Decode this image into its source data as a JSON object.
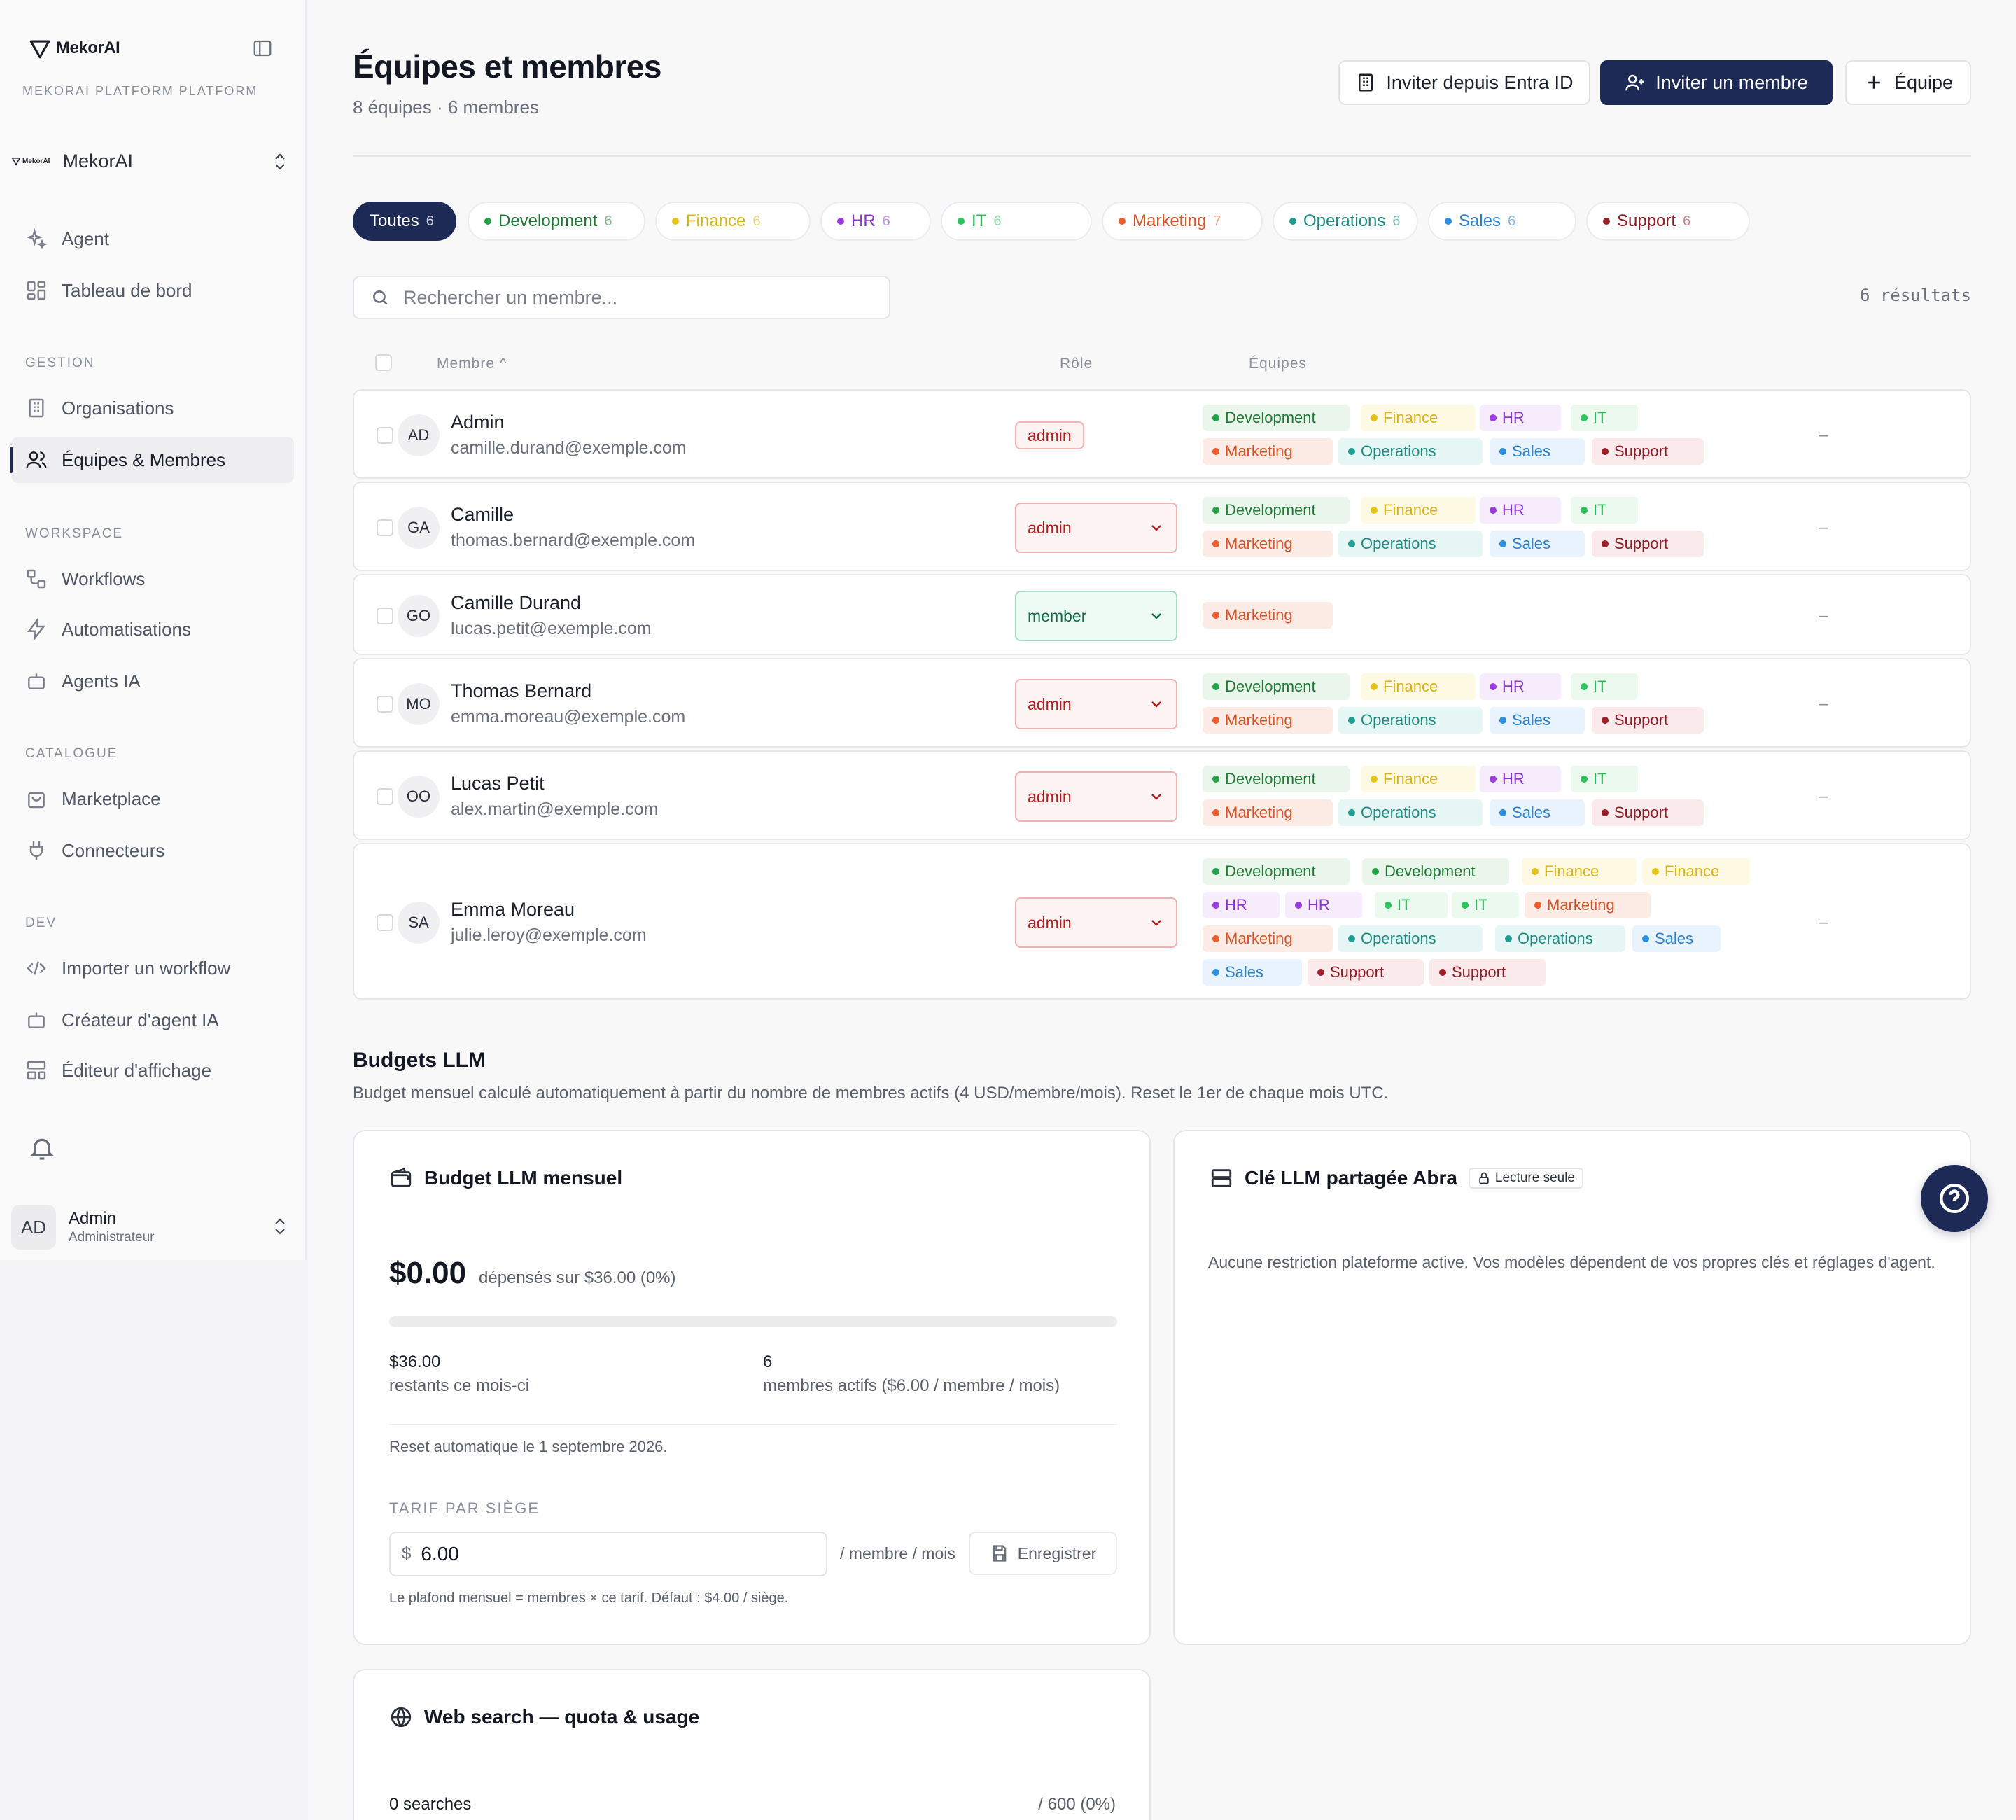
{
  "sidebar": {
    "brand": "MekorAI",
    "platform": "MEKORAI PLATFORM PLATFORM",
    "org": {
      "mini": "MekorAI",
      "name": "MekorAI"
    },
    "items": [
      {
        "label": "Agent",
        "icon": "sparkles-icon"
      },
      {
        "label": "Tableau de bord",
        "icon": "dashboard-icon"
      },
      {
        "label": "Organisations",
        "icon": "building-icon"
      },
      {
        "label": "Équipes & Membres",
        "icon": "users-icon"
      },
      {
        "label": "Workflows",
        "icon": "workflow-icon"
      },
      {
        "label": "Automatisations",
        "icon": "bolt-icon"
      },
      {
        "label": "Agents IA",
        "icon": "bot-icon"
      },
      {
        "label": "Marketplace",
        "icon": "bag-icon"
      },
      {
        "label": "Connecteurs",
        "icon": "plug-icon"
      },
      {
        "label": "Importer un workflow",
        "icon": "code-icon"
      },
      {
        "label": "Créateur d'agent IA",
        "icon": "bot-icon"
      },
      {
        "label": "Éditeur d'affichage",
        "icon": "layout-icon"
      }
    ],
    "sections": {
      "gestion": "GESTION",
      "workspace": "WORKSPACE",
      "catalogue": "CATALOGUE",
      "dev": "DEV"
    },
    "user": {
      "initials": "AD",
      "name": "Admin",
      "role": "Administrateur"
    }
  },
  "header": {
    "title": "Équipes et membres",
    "subtitle": "8 équipes · 6 membres",
    "btn_entra": "Inviter depuis Entra ID",
    "btn_invite": "Inviter un membre",
    "btn_team": "Équipe"
  },
  "filters": [
    {
      "label": "Toutes",
      "count": "6"
    },
    {
      "label": "Development",
      "count": "6",
      "color": "#22a046"
    },
    {
      "label": "Finance",
      "count": "6",
      "color": "#e3c21b"
    },
    {
      "label": "HR",
      "count": "6",
      "color": "#9b3de0"
    },
    {
      "label": "IT",
      "count": "6",
      "color": "#2bc25c"
    },
    {
      "label": "Marketing",
      "count": "7",
      "color": "#ee5a2b"
    },
    {
      "label": "Operations",
      "count": "6",
      "color": "#1e9d93"
    },
    {
      "label": "Sales",
      "count": "6",
      "color": "#2b8fe0"
    },
    {
      "label": "Support",
      "count": "6",
      "color": "#9c1f2a"
    }
  ],
  "search": {
    "placeholder": "Rechercher un membre...",
    "results": "6 résultats"
  },
  "table": {
    "headers": {
      "member": "Membre ^",
      "role": "Rôle",
      "teams": "Équipes"
    },
    "rows": [
      {
        "initials": "AD",
        "name": "Admin",
        "email": "camille.durand@exemple.com",
        "role": "admin",
        "teams": [
          "Development",
          "Finance",
          "HR",
          "IT",
          "Marketing",
          "Operations",
          "Sales",
          "Support"
        ],
        "dash": "–"
      },
      {
        "initials": "GA",
        "name": "Camille",
        "email": "thomas.bernard@exemple.com",
        "role": "admin",
        "teams": [
          "Development",
          "Finance",
          "HR",
          "IT",
          "Marketing",
          "Operations",
          "Sales",
          "Support"
        ],
        "dash": "–"
      },
      {
        "initials": "GO",
        "name": "Camille Durand",
        "email": "lucas.petit@exemple.com",
        "role": "member",
        "teams": [
          "Marketing"
        ],
        "dash": "–"
      },
      {
        "initials": "MO",
        "name": "Thomas Bernard",
        "email": "emma.moreau@exemple.com",
        "role": "admin",
        "teams": [
          "Development",
          "Finance",
          "HR",
          "IT",
          "Marketing",
          "Operations",
          "Sales",
          "Support"
        ],
        "dash": "–"
      },
      {
        "initials": "OO",
        "name": "Lucas Petit",
        "email": "alex.martin@exemple.com",
        "role": "admin",
        "teams": [
          "Development",
          "Finance",
          "HR",
          "IT",
          "Marketing",
          "Operations",
          "Sales",
          "Support"
        ],
        "dash": "–"
      },
      {
        "initials": "SA",
        "name": "Emma Moreau",
        "email": "julie.leroy@exemple.com",
        "role": "admin",
        "teams": [
          "Development",
          "Development",
          "Finance",
          "Finance",
          "HR",
          "HR",
          "IT",
          "IT",
          "Marketing",
          "Marketing",
          "Operations",
          "Operations",
          "Sales",
          "Sales",
          "Support",
          "Support"
        ],
        "dash": "–"
      }
    ]
  },
  "budgets": {
    "title": "Budgets LLM",
    "subtitle": "Budget mensuel calculé automatiquement à partir du nombre de membres actifs (4 USD/membre/mois). Reset le 1er de chaque mois UTC.",
    "monthly": {
      "title": "Budget LLM mensuel",
      "spent": "$0.00",
      "spent_label": "dépensés sur $36.00 (0%)",
      "progress": 0,
      "remaining": "$36.00",
      "remaining_label": "restants ce mois-ci",
      "members": "6",
      "members_label": "membres actifs ($6.00 / membre / mois)",
      "reset": "Reset automatique le 1 septembre 2026.",
      "tarif_label": "TARIF PAR SIÈGE",
      "currency": "$",
      "price": "6.00",
      "unit": "/ membre / mois",
      "save": "Enregistrer",
      "note": "Le plafond mensuel = membres × ce tarif. Défaut : $4.00 / siège."
    },
    "shared": {
      "title": "Clé LLM partagée Abra",
      "badge": "Lecture seule",
      "text": "Aucune restriction plateforme active. Vos modèles dépendent de vos propres clés et réglages d'agent."
    },
    "websearch": {
      "title": "Web search — quota & usage",
      "count": "0 searches",
      "max": "/ 600 (0%)"
    }
  },
  "colors": {
    "Development": {
      "dot": "#22a046",
      "bg": "#eaf6ec",
      "fg": "#1f7a36"
    },
    "Finance": {
      "dot": "#e3c21b",
      "bg": "#fdf9e3",
      "fg": "#d8b41b"
    },
    "HR": {
      "dot": "#9b3de0",
      "bg": "#f6ecfc",
      "fg": "#8b35cf"
    },
    "IT": {
      "dot": "#2bc25c",
      "bg": "#ebf9ef",
      "fg": "#31b85c"
    },
    "Marketing": {
      "dot": "#ee5a2b",
      "bg": "#fdece6",
      "fg": "#d9532a"
    },
    "Operations": {
      "dot": "#1e9d93",
      "bg": "#e6f6f5",
      "fg": "#1f8c84"
    },
    "Sales": {
      "dot": "#2b8fe0",
      "bg": "#e8f3fd",
      "fg": "#2c82cc"
    },
    "Support": {
      "dot": "#9c1f2a",
      "bg": "#fbeaeb",
      "fg": "#8e1f28"
    }
  }
}
